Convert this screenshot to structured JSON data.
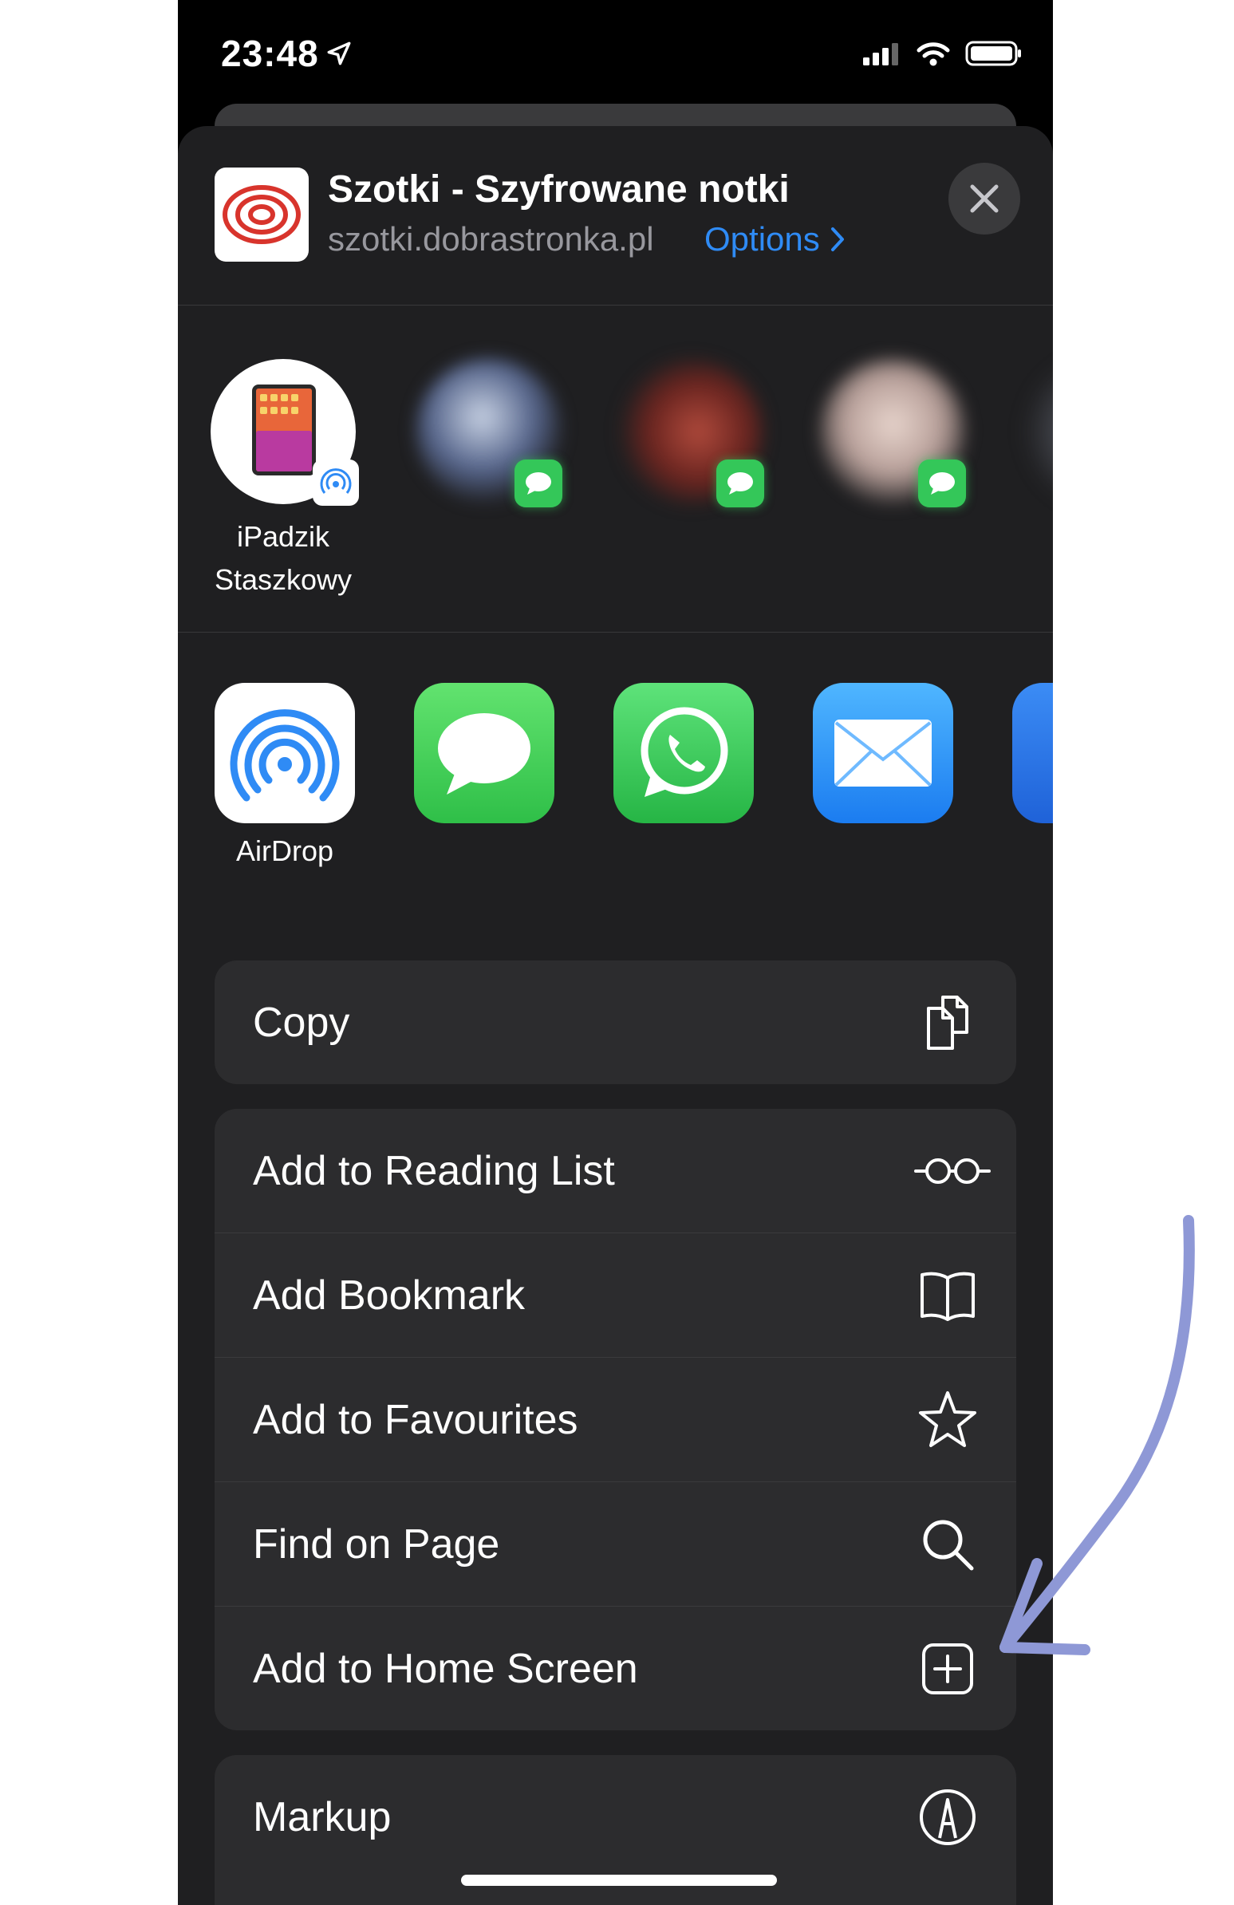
{
  "status": {
    "time": "23:48"
  },
  "header": {
    "title": "Szotki - Szyfrowane notki",
    "url": "szotki.dobrastronka.pl",
    "options_label": "Options"
  },
  "people": [
    {
      "name_line1": "iPadzik",
      "name_line2": "Staszkowy"
    }
  ],
  "apps": [
    {
      "label": "AirDrop"
    }
  ],
  "actions": {
    "copy": "Copy",
    "reading_list": "Add to Reading List",
    "bookmark": "Add Bookmark",
    "favourites": "Add to Favourites",
    "find": "Find on Page",
    "home_screen": "Add to Home Screen",
    "markup": "Markup"
  },
  "colors": {
    "accent": "#2f8bf5",
    "sheet": "#1f1f21",
    "row": "#2c2c2e",
    "annotation_arrow": "#8e98d6"
  }
}
